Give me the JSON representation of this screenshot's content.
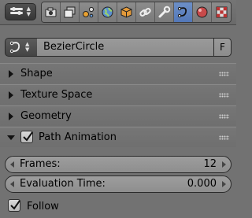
{
  "header": {
    "editor_type_icon": "properties-editor-icon",
    "tabs": [
      {
        "icon": "render-icon",
        "active": false
      },
      {
        "icon": "render-layers-icon",
        "active": false
      },
      {
        "icon": "scene-icon",
        "active": false
      },
      {
        "icon": "world-icon",
        "active": false
      },
      {
        "icon": "object-icon",
        "active": false
      },
      {
        "icon": "constraints-icon",
        "active": false
      },
      {
        "icon": "modifiers-wrench-icon",
        "active": false
      },
      {
        "icon": "curve-data-icon",
        "active": true
      },
      {
        "icon": "material-icon",
        "active": false
      },
      {
        "icon": "texture-icon",
        "active": false
      }
    ]
  },
  "datablock": {
    "type_icon": "curve-data-icon",
    "name": "BezierCircle",
    "fake_user_label": "F"
  },
  "panels": {
    "shape": {
      "title": "Shape",
      "expanded": false
    },
    "texture_space": {
      "title": "Texture Space",
      "expanded": false
    },
    "geometry": {
      "title": "Geometry",
      "expanded": false
    },
    "path_animation": {
      "title": "Path Animation",
      "expanded": true,
      "enabled": true
    }
  },
  "path_animation": {
    "frames": {
      "label": "Frames:",
      "value": "12"
    },
    "evaluation_time": {
      "label": "Evaluation Time:",
      "value": "0.000"
    },
    "follow": {
      "label": "Follow",
      "checked": true
    }
  },
  "colors": {
    "background": "#727272",
    "active_tab": "#5a80c0",
    "field": "#949494"
  }
}
